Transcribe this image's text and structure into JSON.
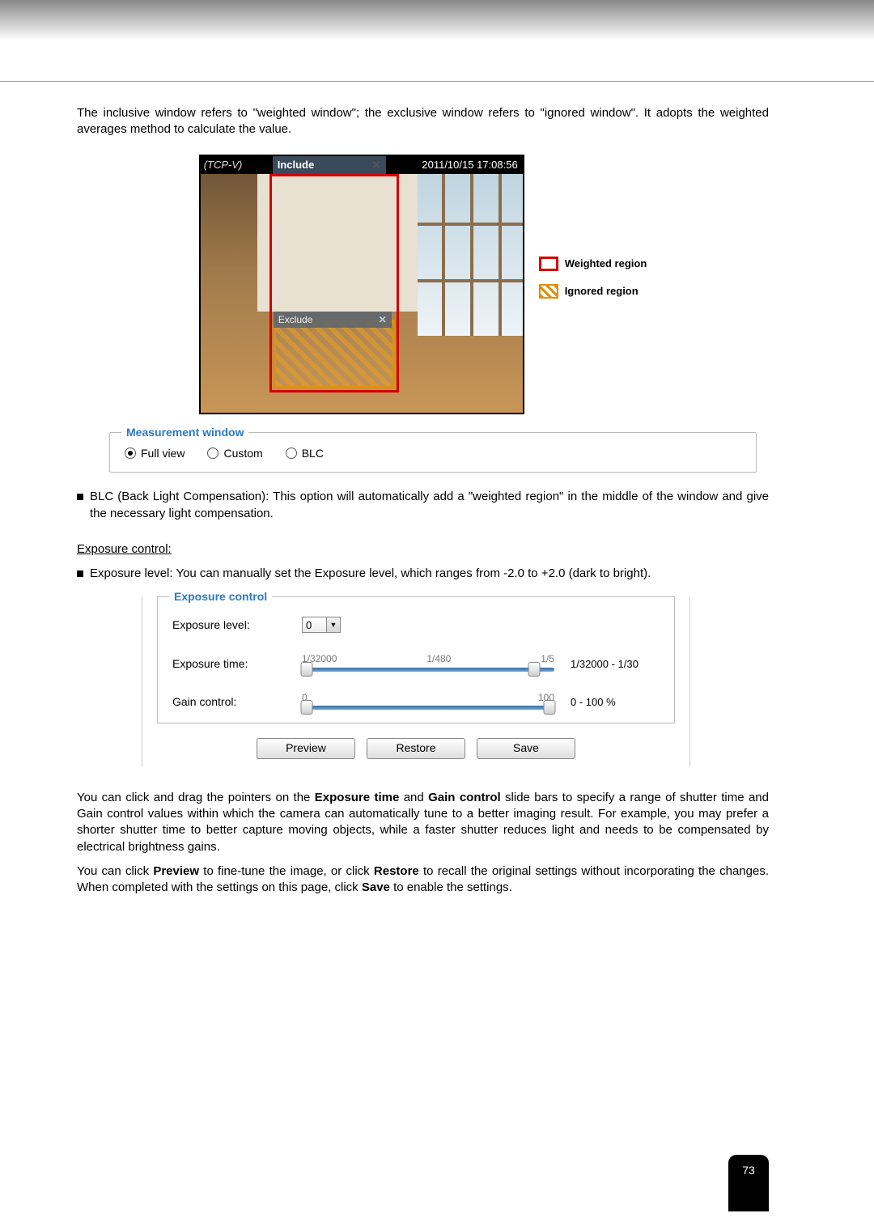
{
  "intro_paragraph": "The inclusive window refers to \"weighted window\"; the exclusive window refers to \"ignored window\". It adopts the weighted averages method to calculate the value.",
  "camera": {
    "label_left": "(TCP-V)",
    "include_label": "Include",
    "timestamp": "2011/10/15  17:08:56",
    "exclude_label": "Exclude"
  },
  "legend": {
    "weighted": "Weighted region",
    "ignored": "Ignored region"
  },
  "measurement": {
    "title": "Measurement window",
    "options": {
      "full_view": "Full view",
      "custom": "Custom",
      "blc": "BLC"
    }
  },
  "blc_text": "BLC (Back Light Compensation): This option will automatically add a \"weighted region\" in the middle of the window and give the necessary light compensation.",
  "exposure_section_title": "Exposure control:",
  "exposure_level_text_before_bold": "Exposure level: You can manually set the Exposure level, which ranges from -2.0 to +2.0 (dark to bright).",
  "exposure_panel": {
    "title": "Exposure control",
    "level_label": "Exposure level:",
    "level_value": "0",
    "time_label": "Exposure time:",
    "time_scale": {
      "min": "1/32000",
      "mid": "1/480",
      "max": "1/5"
    },
    "time_range": "1/32000 - 1/30",
    "gain_label": "Gain control:",
    "gain_scale": {
      "min": "0",
      "max": "100"
    },
    "gain_range": "0 - 100 %",
    "buttons": {
      "preview": "Preview",
      "restore": "Restore",
      "save": "Save"
    }
  },
  "paragraph_slider_before": "You can click and drag the pointers on the ",
  "paragraph_slider_bold1": "Exposure time",
  "paragraph_slider_mid": " and ",
  "paragraph_slider_bold2": "Gain control",
  "paragraph_slider_after": " slide bars to specify a range of shutter time and Gain control values within which the camera can automatically tune to a better imaging result. For example, you may prefer a shorter shutter time to better capture moving objects, while a faster shutter reduces light and needs to be compensated by electrical brightness gains.",
  "paragraph_buttons_1": "You can click ",
  "paragraph_buttons_b1": "Preview",
  "paragraph_buttons_2": " to fine-tune the image, or click ",
  "paragraph_buttons_b2": "Restore",
  "paragraph_buttons_3": " to recall the original settings without incorporating the changes. When completed with the settings on this page, click ",
  "paragraph_buttons_b3": "Save",
  "paragraph_buttons_4": " to enable the settings.",
  "page_number": "73"
}
